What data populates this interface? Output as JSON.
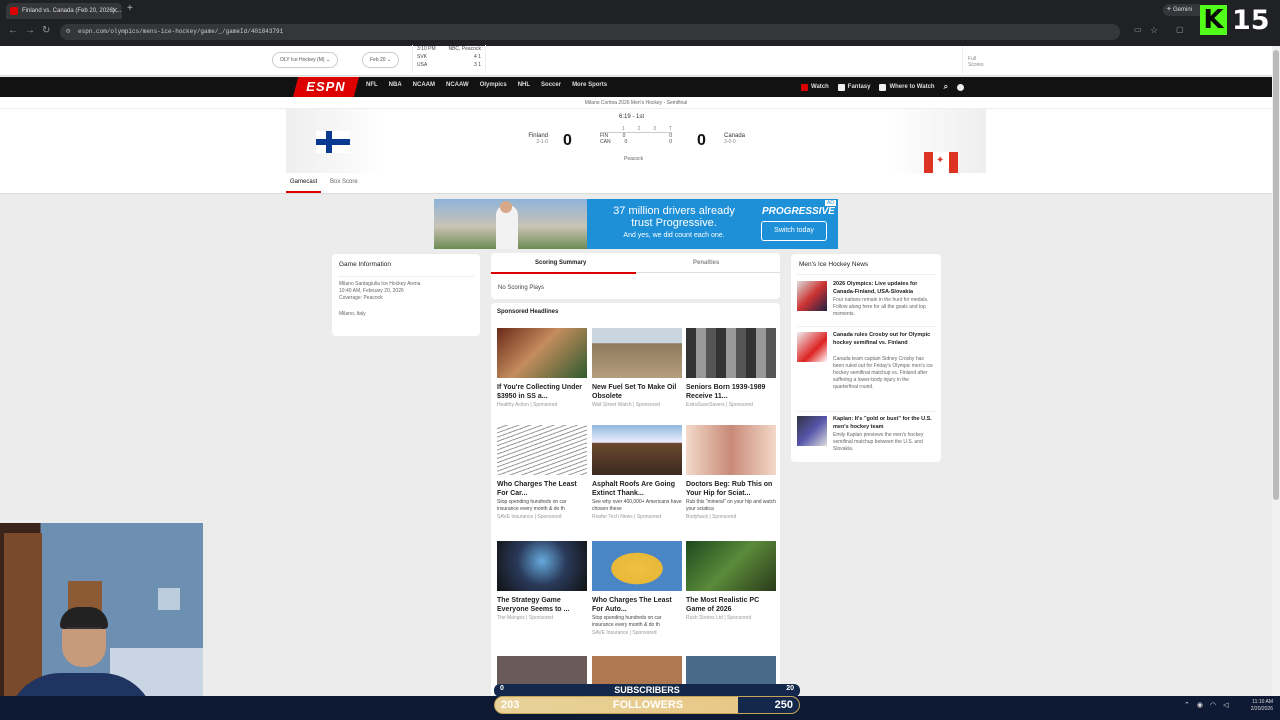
{
  "browser": {
    "tab_title": "Finland vs. Canada (Feb 20, 2026) ...",
    "url": "espn.com/olympics/mens-ice-hockey/game/_/gameId/401843791",
    "gemini_label": "Gemini",
    "kick_badge": "K",
    "counter": "15"
  },
  "scores_strip": {
    "league_select": "OLY Ice Hockey (M)",
    "date_select": "Feb 20",
    "mini_time": "3:10 PM",
    "mini_network": "NBC, Peacock",
    "mini_teams": [
      {
        "abbr": "SVK",
        "score": "4 1"
      },
      {
        "abbr": "USA",
        "score": "3 1"
      }
    ],
    "all_scores": "Full Scores"
  },
  "espn_nav": {
    "logo": "ESPN",
    "items": [
      "NFL",
      "NBA",
      "NCAAM",
      "NCAAW",
      "Olympics",
      "NHL",
      "Soccer",
      "More Sports"
    ],
    "right": [
      "Watch",
      "Fantasy",
      "Where to Watch"
    ]
  },
  "subtitle": "Milano Cortina 2026 Men's Hockey - Semifinal",
  "game": {
    "clock": "6:19 - 1st",
    "home": {
      "name": "Finland",
      "record": "2-1-0",
      "score": "0",
      "abbr": "FIN"
    },
    "away": {
      "name": "Canada",
      "record": "3-0-0",
      "score": "0",
      "abbr": "CAN"
    },
    "periods": [
      "1",
      "2",
      "3",
      "T"
    ],
    "home_line": [
      "0",
      "",
      "",
      "0"
    ],
    "away_line": [
      "0",
      "",
      "",
      "0"
    ],
    "network": "Peacock"
  },
  "game_tabs": [
    "Gamecast",
    "Box Score"
  ],
  "ad": {
    "headline": "37 million drivers already trust Progressive.",
    "sub": "And yes, we did count each one.",
    "brand": "PROGRESSIVE",
    "cta": "Switch today",
    "tag": "AD"
  },
  "game_info": {
    "title": "Game Information",
    "venue": "Milano Santagiulia Ice Hockey Arena",
    "datetime": "10:40 AM, February 20, 2026",
    "coverage": "Coverage: Peacock",
    "location": "Milano, Italy"
  },
  "summary": {
    "tabs": [
      "Scoring Summary",
      "Penalties"
    ],
    "no_plays": "No Scoring Plays",
    "sponsored": "Sponsored Headlines",
    "headlines": [
      {
        "title": "If You're Collecting Under $3950 in SS a...",
        "src": "Healthy Action | Sponsored",
        "desc": ""
      },
      {
        "title": "New Fuel Set To Make Oil Obsolete",
        "src": "Wall Street Watch | Sponsored",
        "desc": ""
      },
      {
        "title": "Seniors Born 1939-1989 Receive 11...",
        "src": "ExtraSaveSavers | Sponsored",
        "desc": ""
      },
      {
        "title": "Who Charges The Least For Car...",
        "src": "SAVE Insurance | Sponsored",
        "desc": "Stop spending hundreds on car insurance every month & do th"
      },
      {
        "title": "Asphalt Roofs Are Going Extinct Thank...",
        "src": "Roofer Tech News | Sponsored",
        "desc": "See why over 400,000+ Americans have chosen these"
      },
      {
        "title": "Doctors Beg: Rub This on Your Hip for Sciat...",
        "src": "Bodyhack | Sponsored",
        "desc": "Rub this \"mineral\" on your hip and watch your sciatica"
      },
      {
        "title": "The Strategy Game Everyone Seems to ...",
        "src": "The Mangos | Sponsored",
        "desc": ""
      },
      {
        "title": "Who Charges The Least For Auto...",
        "src": "SAVE Insurance | Sponsored",
        "desc": "Stop spending hundreds on car insurance every month & do th"
      },
      {
        "title": "The Most Realistic PC Game of 2026",
        "src": "Rush Stories Ltd | Sponsored",
        "desc": ""
      }
    ]
  },
  "news": {
    "title": "Men's Ice Hockey News",
    "items": [
      {
        "title": "2026 Olympics: Live updates for Canada-Finland, USA-Slovakia",
        "desc": "Four nations remain in the hunt for medals. Follow along here for all the goals and top moments."
      },
      {
        "title": "Canada rules Crosby out for Olympic hockey semifinal vs. Finland",
        "desc": "Canada team captain Sidney Crosby has been ruled out for Friday's Olympic men's ice hockey semifinal matchup vs. Finland after suffering a lower-body injury in the quarterfinal round."
      },
      {
        "title": "Kaplan: It's \"gold or bust\" for the U.S. men's hockey team",
        "desc": "Emily Kaplan previews the men's hockey semifinal matchup between the U.S. and Slovakia."
      }
    ]
  },
  "overlay": {
    "subs_label": "SUBSCRIBERS",
    "subs_left": "0",
    "subs_right": "20",
    "followers_label": "FOLLOWERS",
    "followers_count": "203",
    "followers_goal": "250"
  },
  "taskbar": {
    "time": "11:10 AM",
    "date": "2/20/2026"
  },
  "colors": {
    "espn_red": "#dd0000",
    "nav_black": "#121212",
    "progressive_blue": "#1e90d8",
    "kick_green": "#53fc18"
  }
}
